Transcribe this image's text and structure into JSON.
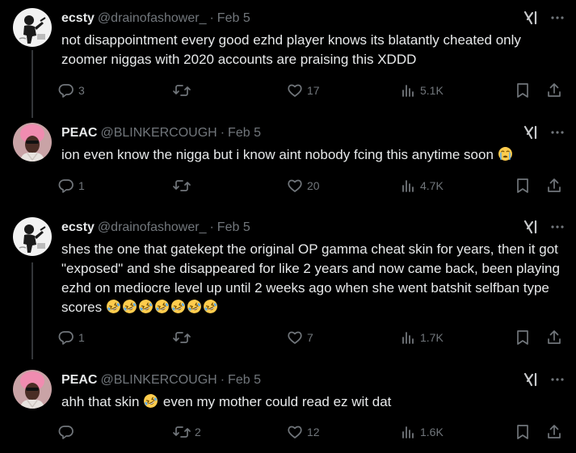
{
  "colors": {
    "background": "#000000",
    "text": "#e7e9ea",
    "secondary": "#71767b",
    "thread_line": "#333639"
  },
  "tweets": [
    {
      "display_name": "ecsty",
      "handle": "@drainofashower_",
      "separator": "·",
      "date": "Feb 5",
      "avatar": "ecsty-avatar",
      "text": "not disappointment every good ezhd player knows its blatantly cheated only zoomer niggas with 2020 accounts are praising this XDDD",
      "emoji_suffix": "",
      "replies": "3",
      "retweets": "",
      "likes": "17",
      "views": "5.1K"
    },
    {
      "display_name": "PEAC",
      "handle": "@BLINKERCOUGH",
      "separator": "·",
      "date": "Feb 5",
      "avatar": "peac-avatar",
      "text": "ion even know the nigga but i know aint nobody fcing this anytime soon",
      "emoji_suffix": "loudly-crying-face",
      "replies": "1",
      "retweets": "",
      "likes": "20",
      "views": "4.7K"
    },
    {
      "display_name": "ecsty",
      "handle": "@drainofashower_",
      "separator": "·",
      "date": "Feb 5",
      "avatar": "ecsty-avatar",
      "text": "shes the one that gatekept the original OP gamma cheat skin for years, then it got \"exposed\" and she disappeared for like 2 years and now came back, been playing ezhd on mediocre level up until 2 weeks ago when she went batshit selfban type scores",
      "emoji_suffix": "rolling-on-floor-laughing x7",
      "replies": "1",
      "retweets": "",
      "likes": "7",
      "views": "1.7K"
    },
    {
      "display_name": "PEAC",
      "handle": "@BLINKERCOUGH",
      "separator": "·",
      "date": "Feb 5",
      "avatar": "peac-avatar",
      "text_before": "ahh that skin",
      "text_after": "even my mother could read ez wit dat",
      "emoji_inline": "rolling-on-floor-laughing",
      "replies": "",
      "retweets": "2",
      "likes": "12",
      "views": "1.6K"
    }
  ],
  "icons": {
    "grok": "grok-icon",
    "more": "more-icon",
    "reply": "reply-icon",
    "retweet": "retweet-icon",
    "like": "like-icon",
    "views": "views-icon",
    "bookmark": "bookmark-icon",
    "share": "share-icon"
  }
}
